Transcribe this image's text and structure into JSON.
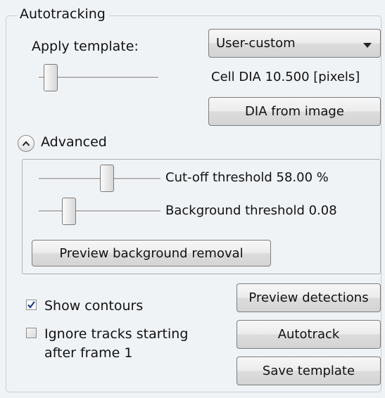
{
  "groupbox": {
    "title": "Autotracking"
  },
  "template": {
    "label": "Apply template:",
    "selected": "User-custom",
    "arrow_icon": "chevron-down-icon"
  },
  "cell": {
    "dia_text": "Cell DIA 10.500 [pixels]",
    "dia_button": "DIA from image"
  },
  "advanced": {
    "label": "Advanced",
    "expander_icon": "chevron-up-icon",
    "cutoff_label": "Cut-off threshold 58.00 %",
    "background_label": "Background threshold 0.08",
    "preview_bg_button": "Preview background removal"
  },
  "options": {
    "show_contours": {
      "label": "Show contours",
      "checked": true
    },
    "ignore_tracks": {
      "line1": "Ignore tracks starting",
      "line2": "after frame 1",
      "checked": false
    }
  },
  "actions": {
    "preview_detections": "Preview detections",
    "autotrack": "Autotrack",
    "save_template": "Save template"
  }
}
